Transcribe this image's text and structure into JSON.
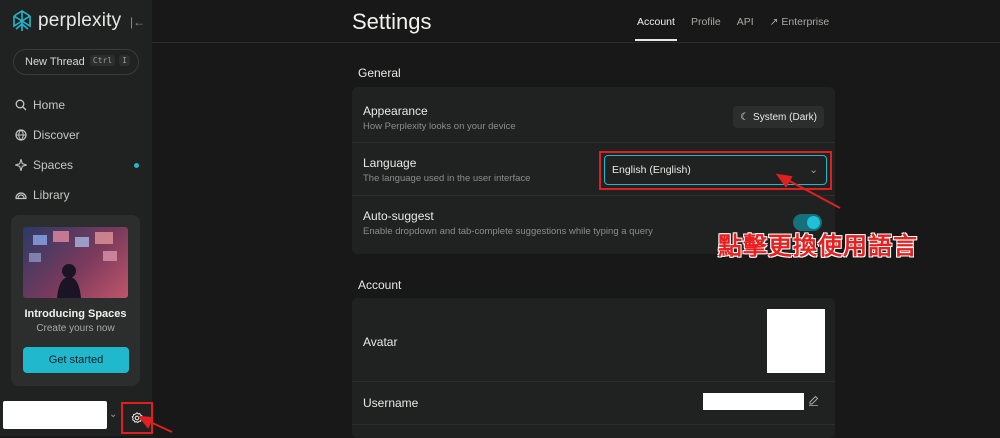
{
  "sidebar": {
    "brand": "perplexity",
    "new_thread": {
      "label": "New Thread",
      "kbd": [
        "Ctrl",
        "I"
      ]
    },
    "nav": [
      {
        "label": "Home",
        "icon": "search-icon"
      },
      {
        "label": "Discover",
        "icon": "globe-icon"
      },
      {
        "label": "Spaces",
        "icon": "spaces-icon",
        "has_dot": true
      },
      {
        "label": "Library",
        "icon": "library-icon"
      }
    ],
    "promo": {
      "title": "Introducing Spaces",
      "subtitle": "Create yours now",
      "button": "Get started"
    }
  },
  "header": {
    "title": "Settings",
    "tabs": [
      {
        "label": "Account",
        "active": true
      },
      {
        "label": "Profile",
        "active": false
      },
      {
        "label": "API",
        "active": false
      },
      {
        "label": "↗ Enterprise",
        "active": false
      }
    ]
  },
  "general": {
    "section_title": "General",
    "appearance": {
      "title": "Appearance",
      "desc": "How Perplexity looks on your device",
      "value": "System (Dark)"
    },
    "language": {
      "title": "Language",
      "desc": "The language used in the user interface",
      "value": "English (English)"
    },
    "autosuggest": {
      "title": "Auto-suggest",
      "desc": "Enable dropdown and tab-complete suggestions while typing a query",
      "enabled": true
    }
  },
  "account": {
    "section_title": "Account",
    "avatar_label": "Avatar",
    "username_label": "Username"
  },
  "annotation": {
    "text": "點擊更換使用語言"
  },
  "colors": {
    "accent": "#20b8cd",
    "annotation": "#e02020",
    "background": "#181818",
    "panel": "#202222"
  }
}
